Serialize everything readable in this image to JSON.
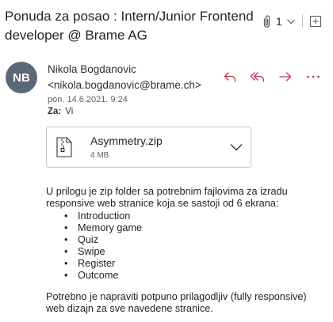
{
  "email": {
    "subject": "Ponuda za posao : Intern/Junior Frontend developer @ Brame AG",
    "attachment_count": "1",
    "sender_initials": "NB",
    "sender": "Nikola Bogdanovic <nikola.bogdanovic@brame.ch>",
    "date": "pon. 14.6.2021. 9:24",
    "to_label": "Za:",
    "to_value": "Vi",
    "attachment": {
      "name": "Asymmetry.zip",
      "size": "4 MB"
    },
    "body": {
      "intro": "U prilogu je zip folder sa potrebnim fajlovima za izradu responsive web stranice koja se sastoji od 6 ekrana:",
      "screens": [
        "Introduction",
        "Memory game",
        "Quiz",
        "Swipe",
        "Register",
        "Outcome"
      ],
      "closing": "Potrebno je napraviti potpuno prilagodljiv (fully responsive) web dizajn za sve navedene stranice."
    }
  },
  "icons": {
    "reply": "reply-icon",
    "reply_all": "reply-all-icon",
    "forward": "forward-icon",
    "more": "more-icon",
    "attachment": "paperclip-icon",
    "zip": "zip-file-icon"
  },
  "colors": {
    "action_red": "#c4314b",
    "avatar_bg": "#5b6878",
    "text": "#252423",
    "muted": "#605e5c"
  }
}
